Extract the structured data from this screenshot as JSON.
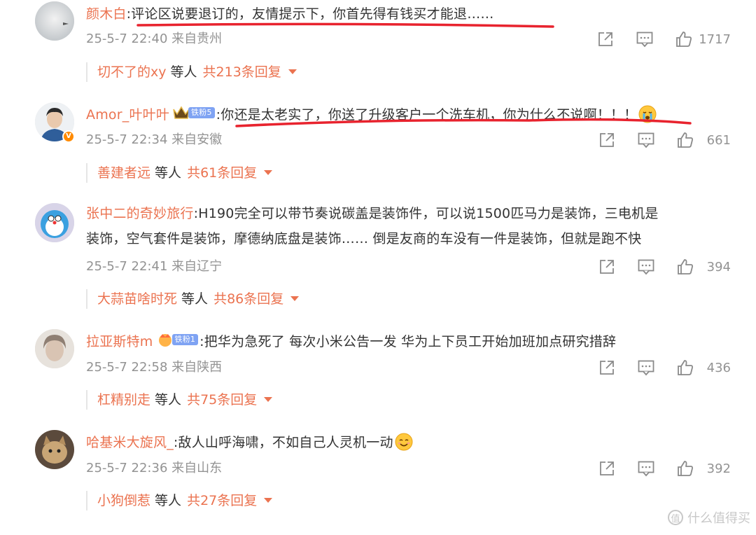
{
  "comments": [
    {
      "username": "颜木白",
      "text": ":评论区说要退订的，友情提示下，你首先得有钱买才能退……",
      "meta": "25-5-7 22:40 来自贵州",
      "likes": "1717",
      "reply_name": "切不了的xy",
      "reply_mid": " 等人",
      "reply_count": "共213条回复"
    },
    {
      "username": "Amor_叶叶叶",
      "fan_badge": "铁粉5",
      "text": ":你还是太老实了，你送了升级客户一个洗车机，你为什么不说啊！！！",
      "meta": "25-5-7 22:34 来自安徽",
      "likes": "661",
      "reply_name": "善建者远",
      "reply_mid": " 等人",
      "reply_count": "共61条回复"
    },
    {
      "username": "张中二的奇妙旅行",
      "text_line1": ":H190完全可以带节奏说碳盖是装饰件，可以说1500匹马力是装饰，三电机是",
      "text_line2": "装饰，空气套件是装饰，摩德纳底盘是装饰…… 倒是友商的车没有一件是装饰，但就是跑不快",
      "meta": "25-5-7 22:41 来自辽宁",
      "likes": "394",
      "reply_name": "大蒜苗啥时死",
      "reply_mid": " 等人",
      "reply_count": "共86条回复"
    },
    {
      "username": "拉亚斯特m",
      "fan_badge": "铁粉1",
      "text": ":把华为急死了 每次小米公告一发 华为上下员工开始加班加点研究措辞",
      "meta": "25-5-7 22:58 来自陕西",
      "likes": "436",
      "reply_name": "杠精别走",
      "reply_mid": " 等人",
      "reply_count": "共75条回复"
    },
    {
      "username": "哈基米大旋风_",
      "text": ":敌人山呼海啸，不如自己人灵机一动",
      "meta": "25-5-7 22:36 来自山东",
      "likes": "392",
      "reply_name": "小狗倒惹",
      "reply_mid": " 等人",
      "reply_count": "共27条回复"
    }
  ],
  "watermark": "什么值得买",
  "colors": {
    "username": "#eb7350",
    "meta": "#939393",
    "annotation_red": "#e8232e",
    "fan_badge": "#7fa3f3"
  },
  "icons": [
    "share-icon",
    "comment-icon",
    "like-icon",
    "chevron-down-icon",
    "verified-badge-icon",
    "crown-icon",
    "cry-emoji",
    "smile-emoji"
  ]
}
